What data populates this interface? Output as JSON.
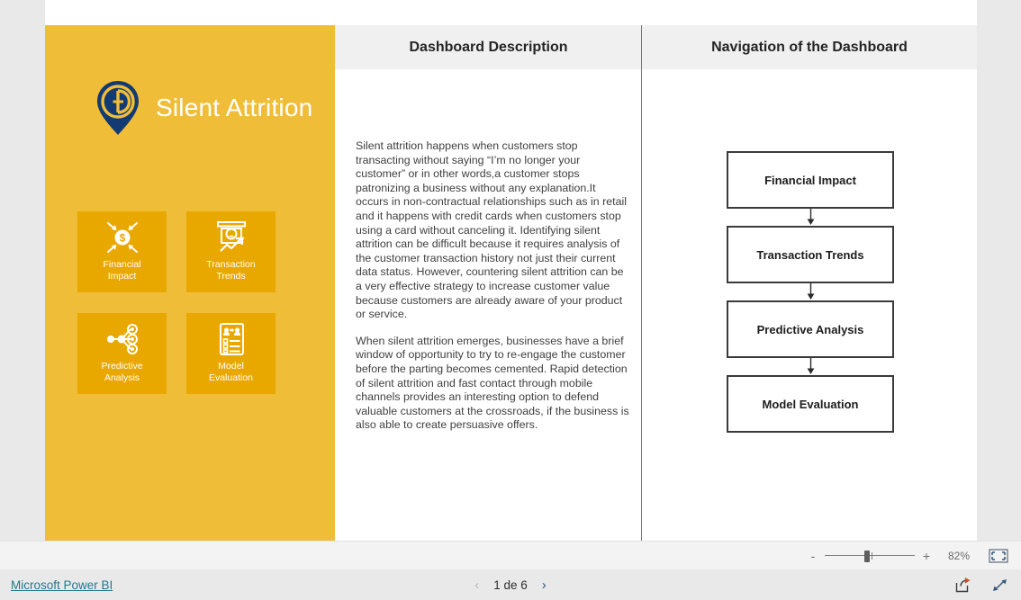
{
  "report": {
    "brand_title": "Silent Attrition",
    "logo_icon": "location-pin-logo-icon",
    "panel_color": "#f0bd38",
    "tile_color": "#e9a800",
    "tiles": [
      {
        "label": "Financial\nImpact",
        "label_line1": "Financial",
        "label_line2": "Impact",
        "icon": "dollar-inward-arrows-icon"
      },
      {
        "label": "Transaction\nTrends",
        "label_line1": "Transaction",
        "label_line2": "Trends",
        "icon": "atm-card-trend-icon"
      },
      {
        "label": "Predictive\nAnalysis",
        "label_line1": "Predictive",
        "label_line2": "Analysis",
        "icon": "network-nodes-icon"
      },
      {
        "label": "Model\nEvaluation",
        "label_line1": "Model",
        "label_line2": "Evaluation",
        "icon": "checklist-people-icon"
      }
    ],
    "headers": {
      "description": "Dashboard Description",
      "navigation": "Navigation of the Dashboard"
    },
    "description_paragraphs": [
      "Silent attrition happens when customers stop transacting without saying “I’m no longer your customer” or in other words,a customer stops patronizing a business without any explanation.It occurs in non-contractual relationships such as in retail and it happens with credit cards when customers stop using a card without canceling it. Identifying silent attrition can be difficult because it requires analysis of the customer transaction history not just their current data status. However, countering silent attrition can be a very effective strategy to increase customer value because customers are already aware of your product or service.",
      "When silent attrition emerges, businesses have a brief window of opportunity to try to re-engage the customer before the parting becomes cemented. Rapid detection of silent attrition and fast contact through mobile channels provides an interesting option to defend valuable customers at the crossroads, if the business is also able to create persuasive offers."
    ],
    "flow_steps": [
      "Financial Impact",
      "Transaction Trends",
      "Predictive Analysis",
      "Model Evaluation"
    ]
  },
  "zoombar": {
    "minus_label": "-",
    "plus_label": "+",
    "zoom_level": "82%",
    "fit_icon": "fit-to-page-icon"
  },
  "footer": {
    "powerbi_link": "Microsoft Power BI",
    "prev_chevron": "‹",
    "next_chevron": "›",
    "page_label": "1 de 6",
    "share_icon": "share-icon",
    "fullscreen_icon": "fullscreen-expand-icon"
  }
}
